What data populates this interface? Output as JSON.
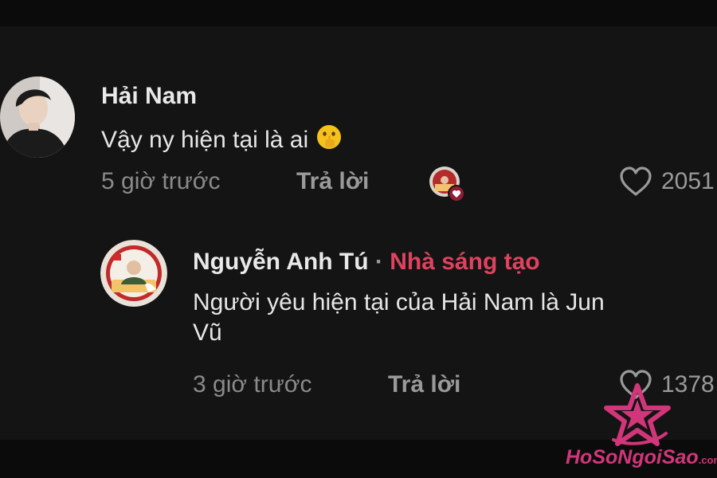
{
  "comment": {
    "author": "Hải Nam",
    "text": "Vậy ny hiện tại là ai",
    "emoji": "shushing-face-icon",
    "time": "5 giờ trước",
    "reply_label": "Trả lời",
    "likes": "2051"
  },
  "reply": {
    "author": "Nguyễn Anh Tú",
    "separator": "·",
    "badge": "Nhà sáng tạo",
    "text_line1": "Người yêu hiện tại của Hải Nam là Jun",
    "text_line2": "Vũ",
    "time": "3 giờ trước",
    "reply_label": "Trả lời",
    "likes": "1378"
  },
  "watermark": {
    "text": "HoSoNgoiSao",
    "suffix": ".com"
  },
  "colors": {
    "background": "#141414",
    "creator_badge": "#e0425e",
    "watermark": "#d1367a"
  }
}
